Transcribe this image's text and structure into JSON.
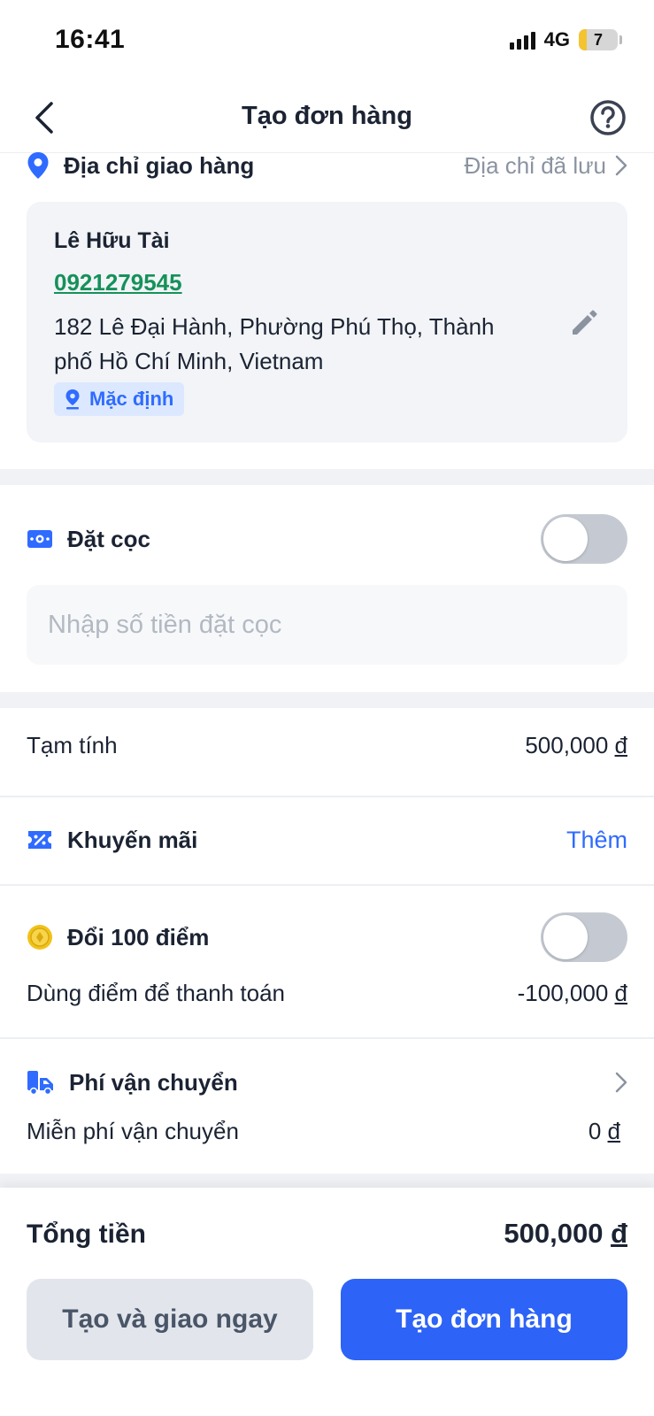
{
  "status_bar": {
    "time": "16:41",
    "network": "4G",
    "battery": "7"
  },
  "header": {
    "title": "Tạo đơn hàng"
  },
  "address": {
    "section_label": "Địa chỉ giao hàng",
    "saved_link": "Địa chỉ đã lưu",
    "name": "Lê Hữu Tài",
    "phone": "0921279545",
    "line": "182 Lê Đại Hành, Phường Phú Thọ, Thành phố Hồ Chí Minh, Vietnam",
    "badge": "Mặc định"
  },
  "deposit": {
    "label": "Đặt cọc",
    "toggle_on": false,
    "input_placeholder": "Nhập số tiền đặt cọc",
    "input_value": ""
  },
  "subtotal": {
    "label": "Tạm tính",
    "amount": "500,000",
    "currency": "đ"
  },
  "promotion": {
    "label": "Khuyến mãi",
    "action": "Thêm"
  },
  "points": {
    "label": "Đổi 100 điểm",
    "toggle_on": false,
    "sub_label": "Dùng điểm để thanh toán",
    "amount": "-100,000",
    "currency": "đ"
  },
  "shipping": {
    "label": "Phí vận chuyển",
    "sub_label": "Miễn phí vận chuyển",
    "amount": "0",
    "currency": "đ"
  },
  "footer": {
    "total_label": "Tổng tiền",
    "total_amount": "500,000",
    "currency": "đ",
    "secondary_button": "Tạo và giao ngay",
    "primary_button": "Tạo đơn hàng"
  },
  "colors": {
    "accent": "#2d63f6",
    "phone": "#16915a",
    "toggle_off": "#c5cad2",
    "coin": "#f2c21b"
  },
  "icons": [
    "back-arrow",
    "help",
    "location-pin",
    "chevron-right",
    "pencil",
    "cash",
    "discount-ticket",
    "coin",
    "delivery-truck"
  ]
}
